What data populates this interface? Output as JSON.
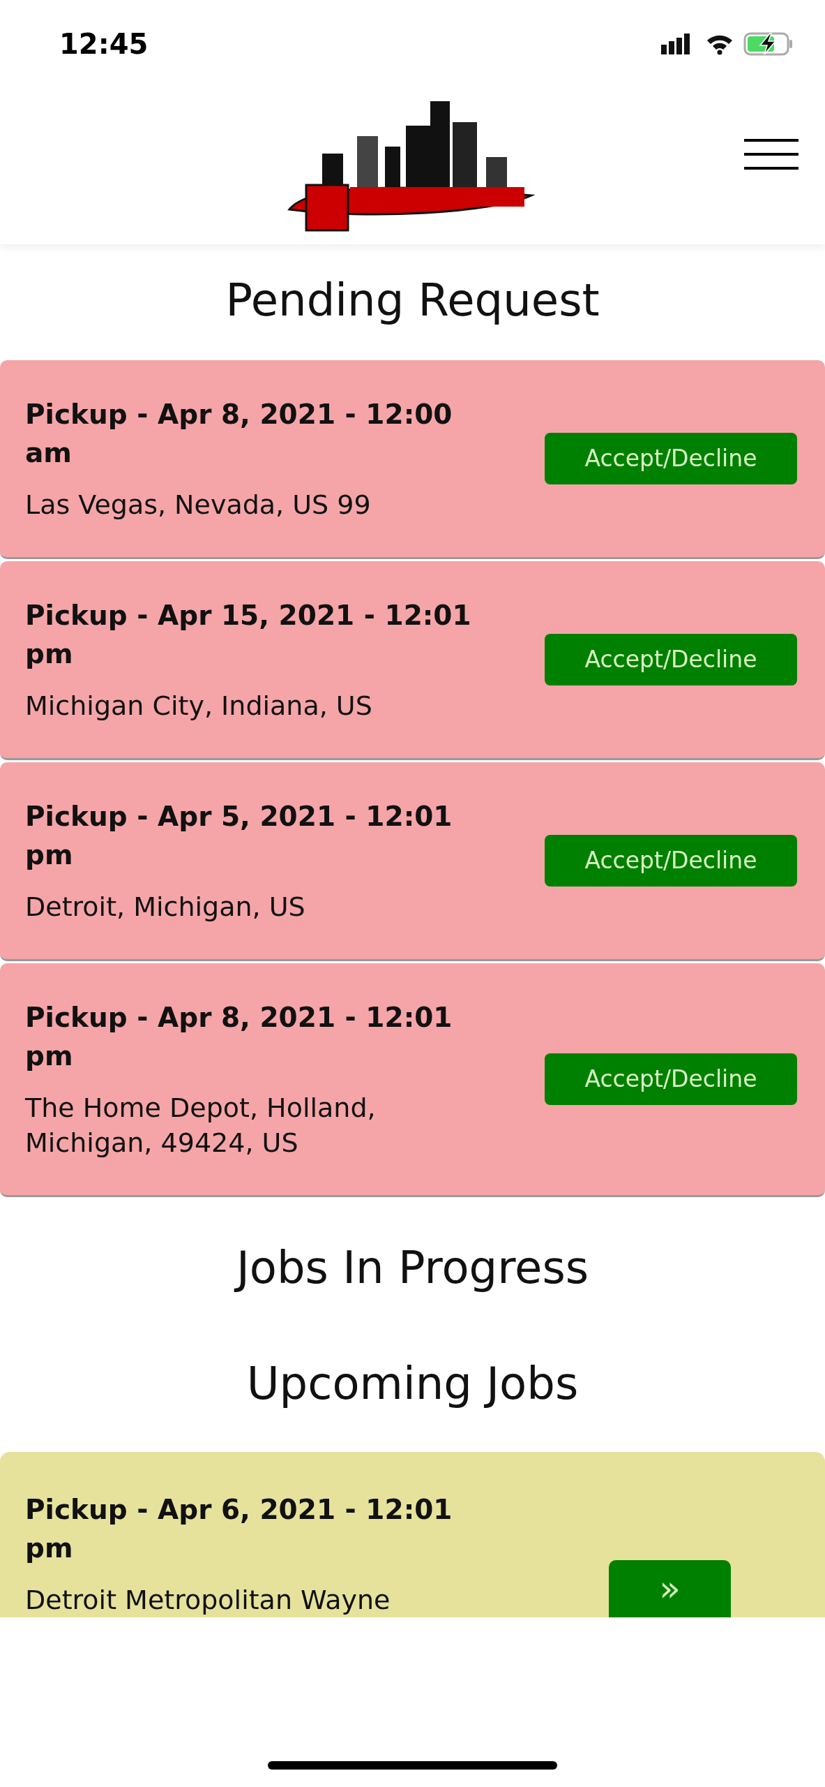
{
  "status_bar": {
    "time": "12:45"
  },
  "pending": {
    "title": "Pending Request",
    "requests": [
      {
        "title": "Pickup - Apr 8, 2021 - 12:00 am",
        "location": "Las Vegas, Nevada, US 99",
        "action": "Accept/Decline"
      },
      {
        "title": "Pickup - Apr 15, 2021 - 12:01 pm",
        "location": "Michigan City, Indiana, US",
        "action": "Accept/Decline"
      },
      {
        "title": "Pickup - Apr 5, 2021 - 12:01 pm",
        "location": "Detroit, Michigan, US",
        "action": "Accept/Decline"
      },
      {
        "title": "Pickup - Apr 8, 2021 - 12:01 pm",
        "location": "The Home Depot, Holland, Michigan, 49424, US",
        "action": "Accept/Decline"
      }
    ]
  },
  "in_progress": {
    "title": "Jobs In Progress"
  },
  "upcoming": {
    "title": "Upcoming Jobs",
    "jobs": [
      {
        "title": "Pickup - Apr 6, 2021 - 12:01 pm",
        "location": "Detroit Metropolitan Wayne",
        "action": "»"
      }
    ]
  }
}
